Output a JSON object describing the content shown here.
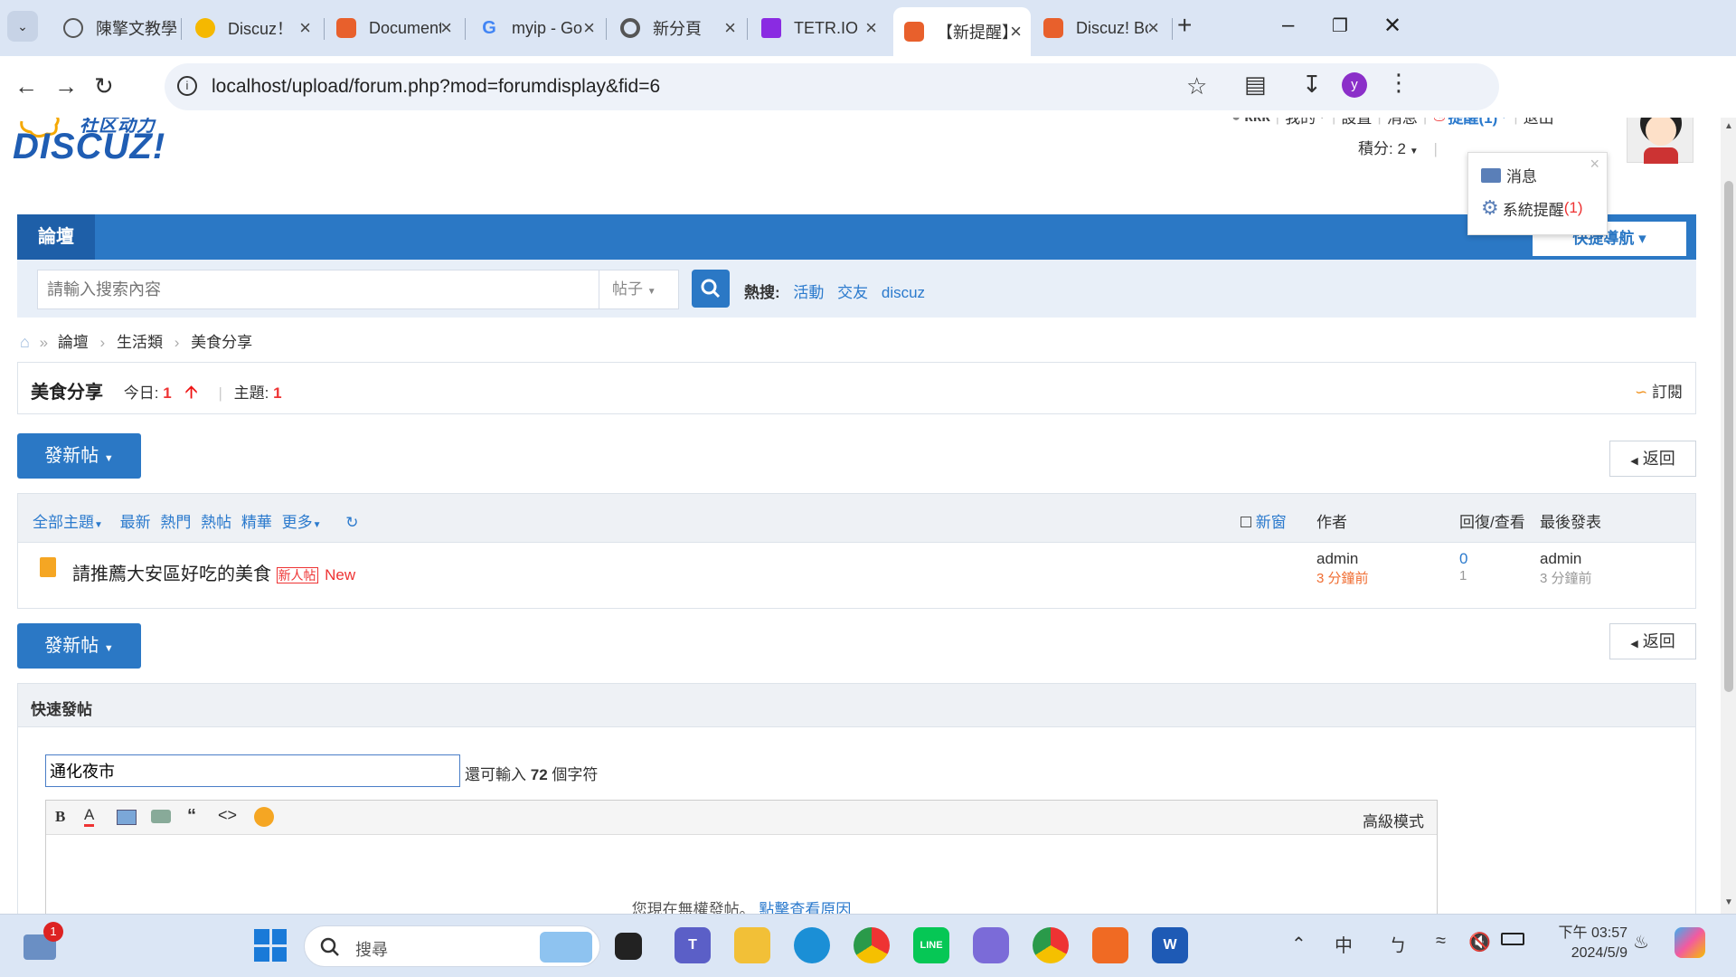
{
  "browser": {
    "tabs": [
      {
        "label": "陳擎文教學",
        "icon": "globe-icon",
        "color": "#555"
      },
      {
        "label": "Discuz！官",
        "icon": "bulb-icon",
        "color": "#f5b800"
      },
      {
        "label": "Document",
        "icon": "discuz-icon",
        "color": "#e8602c"
      },
      {
        "label": "myip - Go",
        "icon": "google-icon",
        "color": "#4285f4"
      },
      {
        "label": "新分頁",
        "icon": "chrome-icon",
        "color": "#555"
      },
      {
        "label": "TETR.IO",
        "icon": "tetrio-icon",
        "color": "#8a2be2"
      },
      {
        "label": "【新提醒】",
        "icon": "discuz-icon",
        "color": "#e8602c"
      },
      {
        "label": "Discuz! Bo",
        "icon": "discuz-icon",
        "color": "#e8602c"
      }
    ],
    "url": "localhost/upload/forum.php?mod=forumdisplay&fid=6",
    "profile_initial": "y"
  },
  "header": {
    "logo_text": "DISCUZ!",
    "logo_sub": "社区动力",
    "username": "kkk",
    "my": "我的",
    "settings": "設置",
    "messages": "消息",
    "reminder": "提醒(1)",
    "logout": "退出",
    "credits": "積分: 2"
  },
  "dropdown": {
    "items": [
      "消息",
      "系統提醒"
    ],
    "count": "(1)"
  },
  "nav": {
    "forum": "論壇",
    "quick_nav": "快捷導航"
  },
  "search": {
    "placeholder": "請輸入搜索內容",
    "type": "帖子",
    "hot_label": "熱搜:",
    "hot": [
      "活動",
      "交友",
      "discuz"
    ]
  },
  "breadcrumb": [
    "論壇",
    "生活類",
    "美食分享"
  ],
  "forum": {
    "name": "美食分享",
    "today_label": "今日:",
    "today": "1",
    "topics_label": "主題:",
    "topics": "1",
    "subscribe": "訂閱"
  },
  "actions": {
    "new_post": "發新帖",
    "back": "返回"
  },
  "thread_list": {
    "filters": [
      "全部主題",
      "最新",
      "熱門",
      "熱帖",
      "精華",
      "更多"
    ],
    "new_window": "新窗",
    "col_author": "作者",
    "col_replies": "回復/查看",
    "col_last": "最後發表",
    "threads": [
      {
        "title": "請推薦大安區好吃的美食",
        "badge": "新人帖",
        "new_tag": "New",
        "author": "admin",
        "author_time": "3 分鐘前",
        "replies": "0",
        "views": "1",
        "last_author": "admin",
        "last_time": "3 分鐘前"
      }
    ]
  },
  "quick_post": {
    "title": "快速發帖",
    "subject_value": "通化夜市",
    "remaining_prefix": "還可輸入",
    "remaining": "72",
    "remaining_suffix": "個字符",
    "advanced": "高級模式",
    "no_permission": "您現在無權發帖。",
    "see_reason": "點擊查看原因"
  },
  "taskbar": {
    "search_placeholder": "搜尋",
    "notif_count": "1",
    "ime1": "中",
    "ime2": "ㄅ",
    "time": "下午 03:57",
    "date": "2024/5/9"
  }
}
